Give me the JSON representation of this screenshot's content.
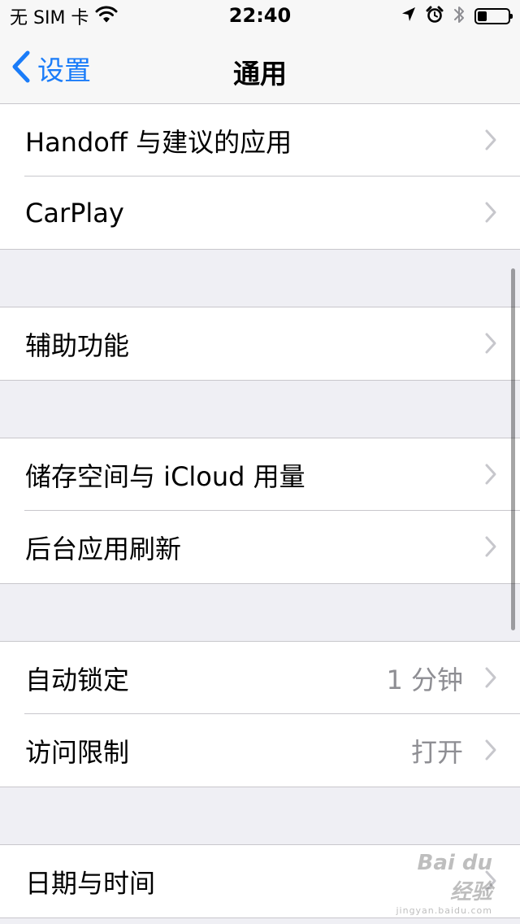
{
  "status_bar": {
    "carrier": "无 SIM 卡",
    "time": "22:40",
    "battery_level": 0.3
  },
  "nav": {
    "back_label": "设置",
    "title": "通用"
  },
  "groups": [
    [
      {
        "label": "Handoff 与建议的应用",
        "value": ""
      },
      {
        "label": "CarPlay",
        "value": ""
      }
    ],
    [
      {
        "label": "辅助功能",
        "value": ""
      }
    ],
    [
      {
        "label": "储存空间与 iCloud 用量",
        "value": ""
      },
      {
        "label": "后台应用刷新",
        "value": ""
      }
    ],
    [
      {
        "label": "自动锁定",
        "value": "1 分钟"
      },
      {
        "label": "访问限制",
        "value": "打开"
      }
    ],
    [
      {
        "label": "日期与时间",
        "value": ""
      }
    ]
  ],
  "watermark": {
    "brand": "Bai du 经验",
    "url": "jingyan.baidu.com"
  },
  "colors": {
    "accent": "#1a7cf9",
    "separator": "#c8c7cc",
    "background": "#efeff4",
    "chevron": "#c7c7cc",
    "secondary_text": "#8e8e93"
  },
  "icons": {
    "wifi": "wifi-icon",
    "location": "location-arrow-icon",
    "alarm": "alarm-clock-icon",
    "bluetooth": "bluetooth-icon",
    "battery": "battery-icon",
    "back": "chevron-left-icon",
    "disclosure": "chevron-right-icon"
  }
}
